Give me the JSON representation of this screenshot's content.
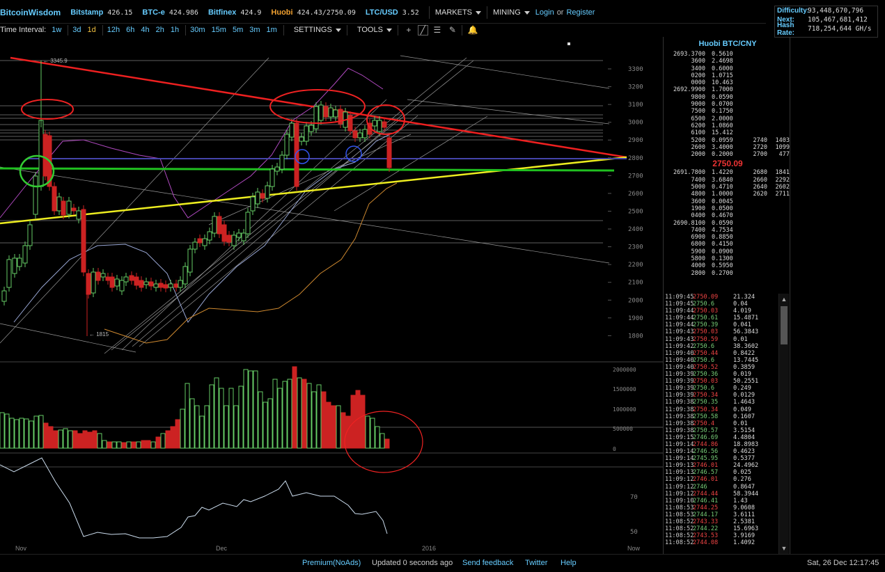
{
  "header": {
    "logo": "BitcoinWisdom",
    "exchanges": [
      {
        "name": "Bitstamp",
        "price": "426.15"
      },
      {
        "name": "BTC-e",
        "price": "424.986"
      },
      {
        "name": "Bitfinex",
        "price": "424.9"
      },
      {
        "name": "Huobi",
        "price": "424.43/2750.09"
      },
      {
        "name": "LTC/USD",
        "price": "3.52"
      }
    ],
    "menus": {
      "markets": "MARKETS",
      "mining": "MINING"
    },
    "login": "Login",
    "or": "or",
    "register": "Register"
  },
  "network": {
    "difficulty_label": "Difficulty:",
    "difficulty": "93,448,670,796",
    "next_label": "Next:",
    "next": "105,467,681,412",
    "hashrate_label": "Hash Rate:",
    "hashrate": "718,254,644 GH/s"
  },
  "toolbar": {
    "time_interval_label": "Time Interval:",
    "intervals": [
      "1w",
      "3d",
      "1d",
      "12h",
      "6h",
      "4h",
      "2h",
      "1h",
      "30m",
      "15m",
      "5m",
      "3m",
      "1m"
    ],
    "active_interval": "1d",
    "settings": "SETTINGS",
    "tools": "TOOLS",
    "tool_icons": [
      "plus-icon",
      "line-tool-icon",
      "fib-icon",
      "draw-icon",
      "bell-icon"
    ]
  },
  "chart": {
    "price_axis": [
      "3300",
      "3200",
      "3100",
      "3000",
      "2900",
      "2800",
      "2700",
      "2600",
      "2500",
      "2400",
      "2300",
      "2200",
      "2100",
      "2000",
      "1900",
      "1800"
    ],
    "volume_axis": [
      "2000000",
      "1500000",
      "1000000",
      "500000",
      "0"
    ],
    "indicator_axis": [
      "70",
      "50"
    ],
    "date_labels": [
      "Nov",
      "Dec",
      "2016",
      "Now"
    ],
    "high_marker": "← 3345.9",
    "low_marker": "← 1815"
  },
  "orderbook": {
    "title": "Huobi BTC/CNY",
    "asks": [
      [
        "2693.3700",
        "0.5610",
        "",
        ""
      ],
      [
        "3600",
        "2.4698",
        "",
        ""
      ],
      [
        "3400",
        "0.6000",
        "",
        ""
      ],
      [
        "0200",
        "1.0715",
        "",
        ""
      ],
      [
        "0000",
        "10.463",
        "",
        ""
      ],
      [
        "2692.9900",
        "1.7000",
        "",
        ""
      ],
      [
        "9800",
        "0.0590",
        "",
        ""
      ],
      [
        "9000",
        "0.0700",
        "",
        ""
      ],
      [
        "7500",
        "0.1750",
        "",
        ""
      ],
      [
        "6500",
        "2.0000",
        "",
        ""
      ],
      [
        "6200",
        "1.0860",
        "",
        ""
      ],
      [
        "6100",
        "15.412",
        "",
        ""
      ],
      [
        "5200",
        "0.0959",
        "2740",
        "1403"
      ],
      [
        "2600",
        "3.4000",
        "2720",
        "1099"
      ],
      [
        "2000",
        "0.2000",
        "2700",
        "477"
      ]
    ],
    "last_price": "2750.09",
    "bids": [
      [
        "2691.7800",
        "1.4220",
        "2680",
        "1841"
      ],
      [
        "7400",
        "3.6840",
        "2660",
        "2292"
      ],
      [
        "5000",
        "0.4710",
        "2640",
        "2602"
      ],
      [
        "4800",
        "1.0000",
        "2620",
        "2711"
      ],
      [
        "3600",
        "0.0045",
        "",
        ""
      ],
      [
        "1900",
        "0.0500",
        "",
        ""
      ],
      [
        "0400",
        "0.4670",
        "",
        ""
      ],
      [
        "2690.8100",
        "0.0590",
        "",
        ""
      ],
      [
        "7400",
        "4.7534",
        "",
        ""
      ],
      [
        "6900",
        "0.8850",
        "",
        ""
      ],
      [
        "6800",
        "0.4150",
        "",
        ""
      ],
      [
        "5900",
        "0.0900",
        "",
        ""
      ],
      [
        "5800",
        "0.1300",
        "",
        ""
      ],
      [
        "4000",
        "0.5950",
        "",
        ""
      ],
      [
        "2800",
        "0.2700",
        "",
        ""
      ]
    ]
  },
  "trades": [
    [
      "11:09:45",
      "2750.09",
      "21.324",
      "down"
    ],
    [
      "11:09:45",
      "2750.6",
      "0.04",
      "up"
    ],
    [
      "11:09:44",
      "2750.03",
      "4.019",
      "down"
    ],
    [
      "11:09:44",
      "2750.61",
      "15.4871",
      "up"
    ],
    [
      "11:09:44",
      "2750.39",
      "0.041",
      "up"
    ],
    [
      "11:09:43",
      "2750.03",
      "56.3843",
      "down"
    ],
    [
      "11:09:43",
      "2750.59",
      "0.01",
      "down"
    ],
    [
      "11:09:42",
      "2750.6",
      "38.3602",
      "up"
    ],
    [
      "11:09:40",
      "2750.44",
      "0.8422",
      "down"
    ],
    [
      "11:09:40",
      "2750.6",
      "13.7445",
      "up"
    ],
    [
      "11:09:40",
      "2750.52",
      "0.3859",
      "down"
    ],
    [
      "11:09:39",
      "2750.36",
      "0.019",
      "up"
    ],
    [
      "11:09:39",
      "2750.03",
      "50.2551",
      "down"
    ],
    [
      "11:09:39",
      "2750.6",
      "0.249",
      "up"
    ],
    [
      "11:09:39",
      "2750.34",
      "0.0129",
      "down"
    ],
    [
      "11:09:38",
      "2750.35",
      "1.4643",
      "up"
    ],
    [
      "11:09:38",
      "2750.34",
      "0.049",
      "down"
    ],
    [
      "11:09:38",
      "2750.58",
      "0.1607",
      "up"
    ],
    [
      "11:09:38",
      "2750.4",
      "0.01",
      "down"
    ],
    [
      "11:09:38",
      "2750.57",
      "3.5154",
      "up"
    ],
    [
      "11:09:15",
      "2746.69",
      "4.4804",
      "up"
    ],
    [
      "11:09:14",
      "2744.86",
      "18.8983",
      "down"
    ],
    [
      "11:09:14",
      "2746.56",
      "0.4623",
      "up"
    ],
    [
      "11:09:14",
      "2745.95",
      "0.5377",
      "up"
    ],
    [
      "11:09:13",
      "2746.01",
      "24.4962",
      "down"
    ],
    [
      "11:09:13",
      "2746.57",
      "0.025",
      "up"
    ],
    [
      "11:09:12",
      "2746.01",
      "0.276",
      "down"
    ],
    [
      "11:09:12",
      "2746",
      "0.8647",
      "up"
    ],
    [
      "11:09:12",
      "2744.44",
      "58.3944",
      "down"
    ],
    [
      "11:09:10",
      "2746.41",
      "1.43",
      "up"
    ],
    [
      "11:08:53",
      "2744.25",
      "9.0608",
      "down"
    ],
    [
      "11:08:53",
      "2744.17",
      "3.6111",
      "up"
    ],
    [
      "11:08:52",
      "2743.33",
      "2.5381",
      "down"
    ],
    [
      "11:08:52",
      "2744.22",
      "15.6963",
      "up"
    ],
    [
      "11:08:52",
      "2743.53",
      "3.9169",
      "down"
    ],
    [
      "11:08:52",
      "2744.08",
      "1.4092",
      "down"
    ]
  ],
  "footer": {
    "premium": "Premium(NoAds)",
    "updated": "Updated 0 seconds ago",
    "feedback": "Send feedback",
    "twitter": "Twitter",
    "help": "Help",
    "datetime": "Sat, 26 Dec 12:17:45"
  },
  "colors": {
    "accent": "#66ccff",
    "up": "#77cc77",
    "down": "#ee4444",
    "huobi": "#f0a030"
  }
}
